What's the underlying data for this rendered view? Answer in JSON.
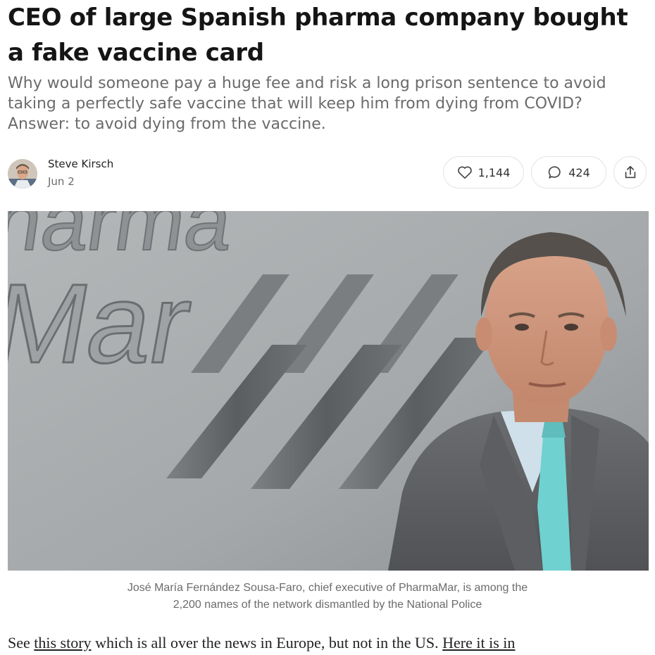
{
  "post": {
    "title": "CEO of large Spanish pharma company bought a fake vaccine card",
    "subtitle": "Why would someone pay a huge fee and risk a long prison sentence to avoid taking a perfectly safe vaccine that will keep him from dying from COVID? Answer: to avoid dying from the vaccine.",
    "author": "Steve Kirsch",
    "date": "Jun 2"
  },
  "actions": {
    "likes": "1,144",
    "comments": "424",
    "like_icon": "heart-icon",
    "comment_icon": "comment-bubble-icon",
    "share_icon": "share-icon"
  },
  "hero": {
    "sign_top": "harma",
    "sign_brand": "Mar"
  },
  "caption": {
    "line1": "José María Fernández Sousa-Faro, chief executive of PharmaMar, is among the",
    "line2": "2,200 names of the network dismantled by the National Police"
  },
  "body": {
    "p1_before": "See ",
    "p1_link1": "this story",
    "p1_middle": " which is all over the news in Europe, but not in the US. ",
    "p1_link2": "Here it is in"
  },
  "colors": {
    "title": "#151515",
    "subtitle": "#6b6b6b",
    "pill_border": "#e3e3e3"
  }
}
